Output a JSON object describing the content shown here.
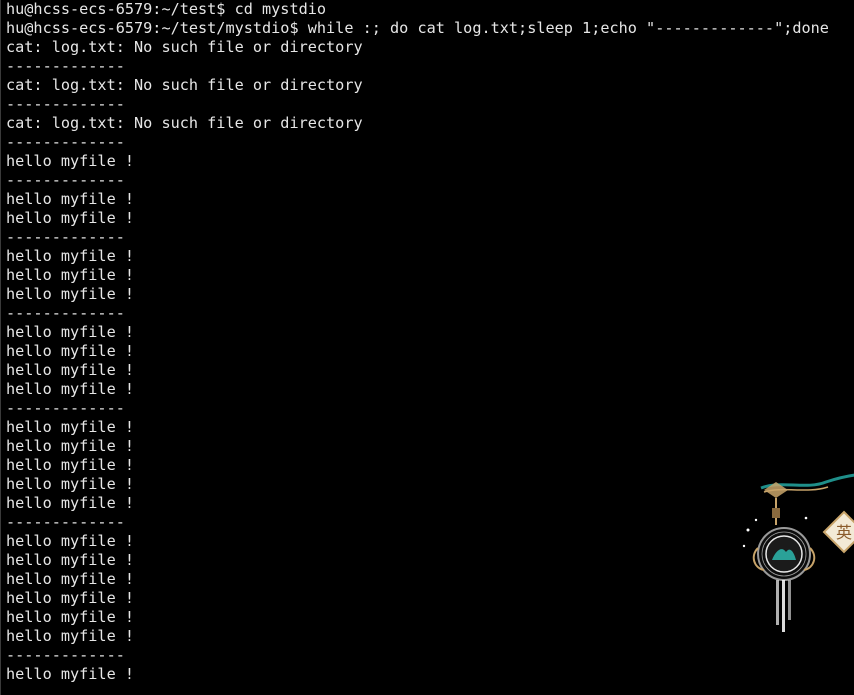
{
  "terminal": {
    "lines": [
      "hu@hcss-ecs-6579:~/test$ cd mystdio",
      "hu@hcss-ecs-6579:~/test/mystdio$ while :; do cat log.txt;sleep 1;echo \"-------------\";done",
      "cat: log.txt: No such file or directory",
      "-------------",
      "cat: log.txt: No such file or directory",
      "-------------",
      "cat: log.txt: No such file or directory",
      "-------------",
      "hello myfile !",
      "-------------",
      "hello myfile !",
      "hello myfile !",
      "-------------",
      "hello myfile !",
      "hello myfile !",
      "hello myfile !",
      "-------------",
      "hello myfile !",
      "hello myfile !",
      "hello myfile !",
      "hello myfile !",
      "-------------",
      "hello myfile !",
      "hello myfile !",
      "hello myfile !",
      "hello myfile !",
      "hello myfile !",
      "-------------",
      "hello myfile !",
      "hello myfile !",
      "hello myfile !",
      "hello myfile !",
      "hello myfile !",
      "hello myfile !",
      "-------------",
      "hello myfile !"
    ]
  },
  "decoration": {
    "icon": "lantern-ornament-icon",
    "badge_text": "英",
    "colors": {
      "teal": "#1f8f8a",
      "gold": "#c8a46a",
      "glow": "#ffffff"
    }
  }
}
